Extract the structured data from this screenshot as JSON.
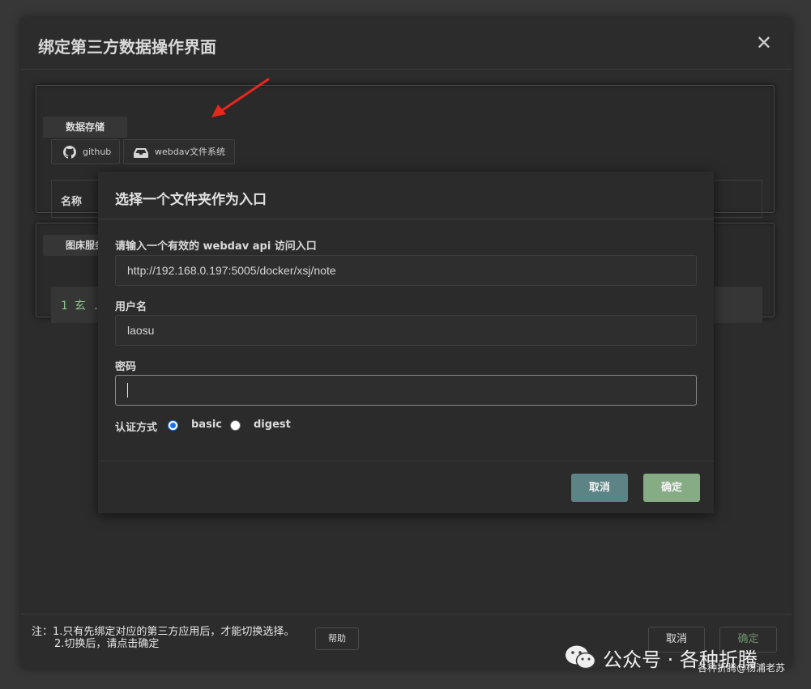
{
  "outer": {
    "title": "绑定第三方数据操作界面",
    "close_glyph": "✕",
    "storage_section_label": "数据存储",
    "tabs": [
      {
        "label": "github",
        "icon": "github-icon"
      },
      {
        "label": "webdav文件系统",
        "icon": "drive-icon"
      }
    ],
    "name_header": "名称",
    "image_section_label": "图床服务",
    "code_line": "1 玄 ...",
    "note_line1": "注：1.只有先绑定对应的第三方应用后，才能切换选择。",
    "note_line2": "2.切换后，请点击确定",
    "help_label": "帮助",
    "cancel_label": "取消",
    "ok_label": "确定"
  },
  "dialog": {
    "title": "选择一个文件夹作为入口",
    "url_label": "请输入一个有效的 webdav api 访问入口",
    "url_value": "http://192.168.0.197:5005/docker/xsj/note",
    "username_label": "用户名",
    "username_value": "laosu",
    "password_label": "密码",
    "password_value": "",
    "auth_label": "认证方式",
    "auth_options": [
      {
        "label": "basic",
        "selected": true
      },
      {
        "label": "digest",
        "selected": false
      }
    ],
    "cancel_label": "取消",
    "ok_label": "确定"
  },
  "watermark": {
    "main": "公众号 · 各种折腾",
    "sub": "各种折腾@杨浦老苏",
    "icon": "wechat-icon"
  },
  "colors": {
    "cancel_button": "#5c8385",
    "ok_button": "#86ac86",
    "radio_selected": "#1a73e8",
    "annotation_arrow": "#e8271e"
  }
}
